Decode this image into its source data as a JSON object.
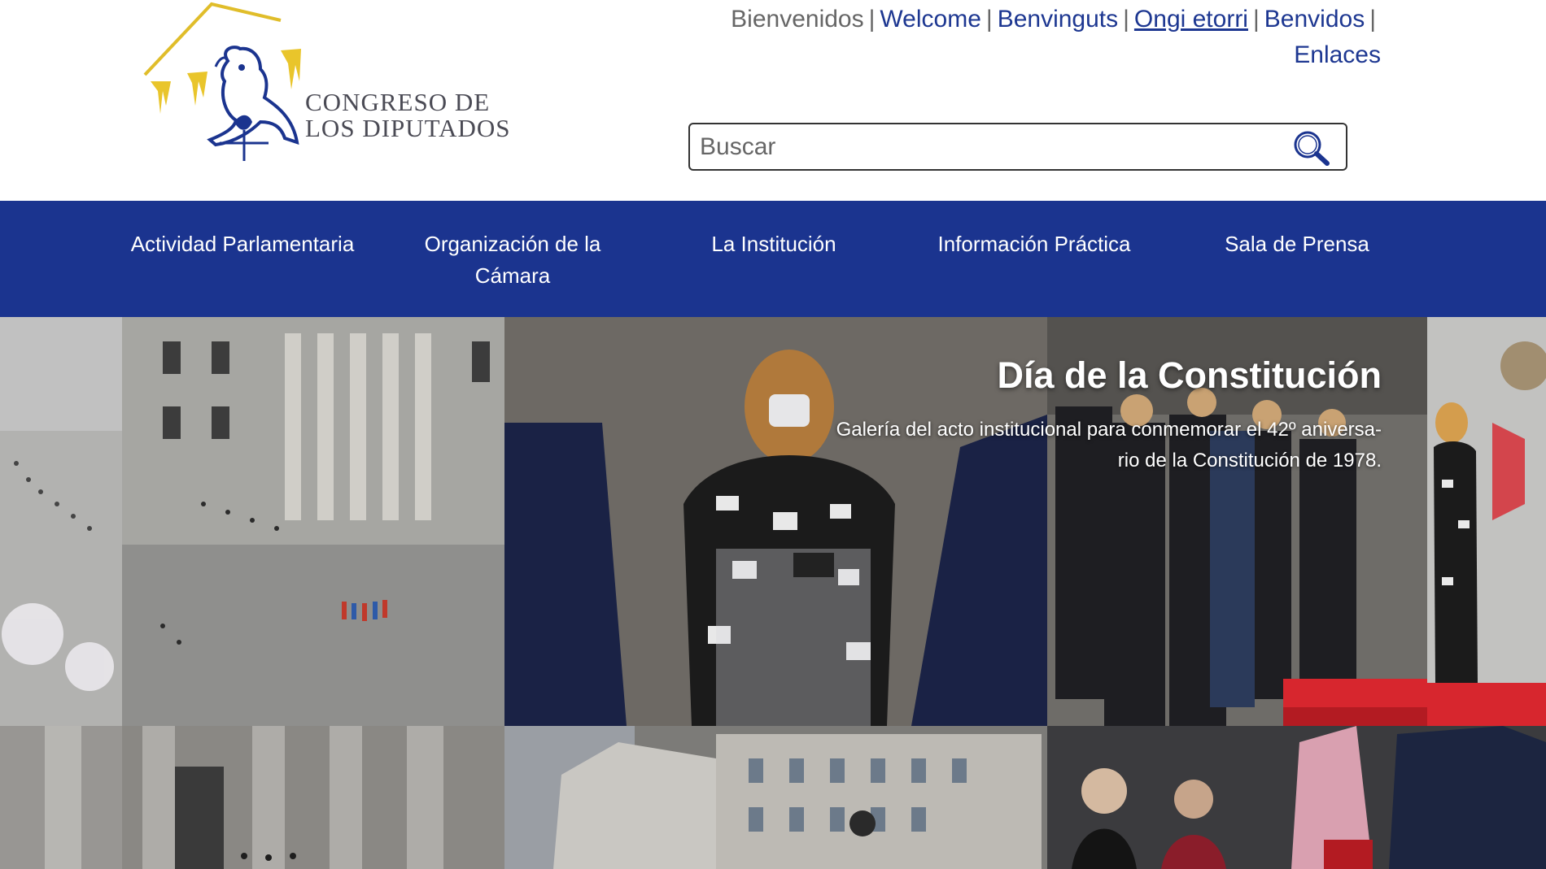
{
  "logo": {
    "line1": "CONGRESO DE",
    "line2": "LOS DIPUTADOS"
  },
  "languages": {
    "current": "Bienvenidos",
    "links": [
      "Welcome",
      "Benvinguts",
      "Ongi etorri",
      "Benvidos"
    ],
    "enlaces": "Enlaces"
  },
  "search": {
    "placeholder": "Buscar",
    "icon": "search-icon"
  },
  "nav": {
    "items": [
      "Actividad Parlamentaria",
      "Organización de la\nCámara",
      "La Institución",
      "Información Práctica",
      "Sala de Prensa"
    ]
  },
  "hero": {
    "title": "Día de la Constitución",
    "description_line1": "Galería del acto institucional para conmemorar el 42º aniversa-",
    "description_line2": "rio de la Constitución de 1978."
  },
  "colors": {
    "nav_bg": "#1b348f",
    "link": "#1d3791",
    "logo_gold": "#e9c52b",
    "logo_blue": "#1b348f"
  }
}
